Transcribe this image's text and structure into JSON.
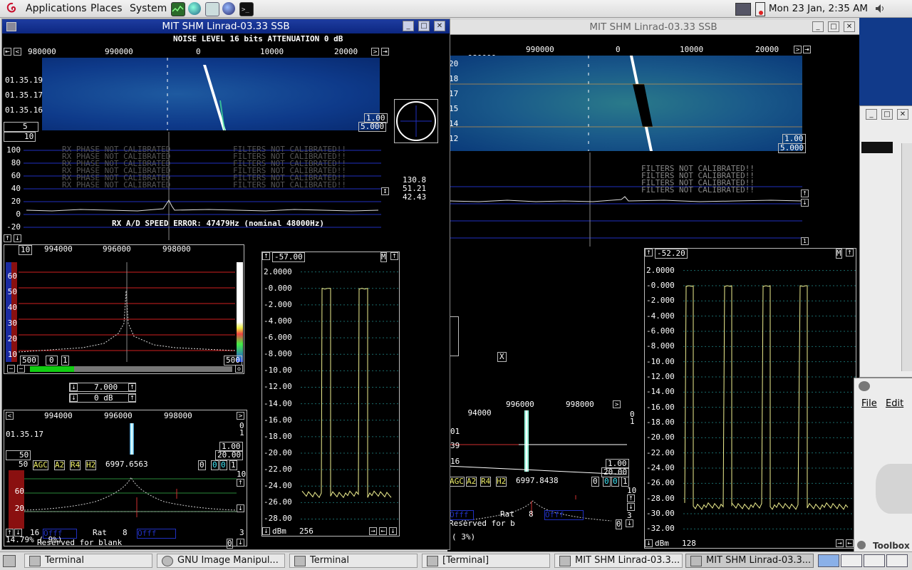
{
  "top_panel": {
    "menus": [
      "Applications",
      "Places",
      "System"
    ],
    "clock": "Mon 23 Jan,  2:35 AM"
  },
  "taskbar": {
    "items": [
      "Terminal",
      "GNU Image Manipul...",
      "Terminal",
      "[Terminal]",
      "MIT SHM Linrad-03.3...",
      "MIT SHM Linrad-03.3..."
    ]
  },
  "win1": {
    "title": "MIT SHM Linrad-03.33 SSB",
    "status": "NOISE LEVEL 16 bits ATTENUATION 0 dB",
    "scale_top": [
      "980000",
      "990000",
      "0",
      "10000",
      "20000"
    ],
    "timestamps": [
      "01.35.19",
      "01.35.17",
      "01.35.16"
    ],
    "wf_gain": "1.00",
    "wf_zero": "5.000",
    "wf_avg": "5",
    "spec_avg": "10",
    "spec_y": [
      "100",
      "80",
      "60",
      "40",
      "20",
      "0",
      "-20"
    ],
    "polar_vals": [
      "130.8",
      "51.21",
      "42.43"
    ],
    "filter_warning": "FILTERS NOT CALIBRATED!!",
    "phase_warning": "RX PHASE NOT CALIBRATED",
    "speed_error": "RX A/D SPEED ERROR: 47479Hz (nominal 48000Hz)",
    "bb_scale": [
      "994000",
      "996000",
      "998000"
    ],
    "bb_avg": "10",
    "bb_y": [
      "60",
      "50",
      "40",
      "30",
      "20",
      "10"
    ],
    "bb_bottom": [
      "500",
      "0",
      "1",
      "500"
    ],
    "freq": "7.000",
    "gain": "0 dB",
    "hires_scale": [
      "994000",
      "996000",
      "998000"
    ],
    "hires_time": "01.35.17",
    "hires_side": [
      "0",
      "1"
    ],
    "hires_gain": "1.00",
    "hires_zero": "20.00",
    "hires_avg": "50",
    "ctrl": {
      "left": "50",
      "agc": "AGC",
      "a2": "A2",
      "r4": "R4",
      "h2": "H2",
      "freq": "6997.6563",
      "v0": "0",
      "v1": "0",
      "v2": "0",
      "v3": "1"
    },
    "bfo_y": [
      "10",
      "60",
      "40",
      "20"
    ],
    "bfo_bottom": {
      "n": "16",
      "rat": "Rat",
      "rat_val": "8",
      "right": "3",
      "zero": "0"
    },
    "cpu": "14.79% ( 9%)",
    "reserved": "Reserved for blank"
  },
  "afc1": {
    "top": "-57.00",
    "m": "M",
    "y": [
      "2.0000",
      "-0.000",
      "-2.000",
      "-4.000",
      "-6.000",
      "-8.000",
      "-10.00",
      "-12.00",
      "-14.00",
      "-16.00",
      "-18.00",
      "-20.00",
      "-22.00",
      "-24.00",
      "-26.00",
      "-28.00"
    ],
    "unit": "dBm",
    "n": "256"
  },
  "win2": {
    "title": "MIT SHM Linrad-03.33 SSB",
    "scale_top": [
      "980000",
      "990000",
      "0",
      "10000",
      "20000"
    ],
    "timestamps": [
      "20",
      "18",
      "17",
      "15",
      "14",
      "12"
    ],
    "wf_gain": "1.00",
    "wf_zero": "5.000",
    "filter_warning": "FILTERS NOT CALIBRATED!!",
    "hires_scale": [
      "94000",
      "996000",
      "998000"
    ],
    "hires_side": [
      "0",
      "1"
    ],
    "hires_times": [
      "01",
      "39",
      "16"
    ],
    "hires_gain": "1.00",
    "hires_zero": "20.00",
    "ctrl": {
      "agc": "AGC",
      "a2": "A2",
      "r4": "R4",
      "h2": "H2",
      "freq": "6997.8438",
      "v0": "0",
      "v1": "0",
      "v2": "0",
      "v3": "1"
    },
    "bfo_y": [
      "10",
      "4",
      "0",
      "3"
    ],
    "bfo_bottom": {
      "rat": "Rat",
      "rat_val": "8"
    },
    "reserved": "Reserved for b",
    "cpu": "( 3%)",
    "close_x": "X"
  },
  "afc2": {
    "top": "-52.20",
    "m": "M",
    "y": [
      "2.0000",
      "-0.000",
      "-2.000",
      "-4.000",
      "-6.000",
      "-8.000",
      "-10.00",
      "-12.00",
      "-14.00",
      "-16.00",
      "-18.00",
      "-20.00",
      "-22.00",
      "-24.00",
      "-26.00",
      "-28.00",
      "-30.00",
      "-32.00"
    ],
    "unit": "dBm",
    "n": "128"
  },
  "gimp": {
    "menu_file": "File",
    "menu_edit": "Edit",
    "toolbox": "Toolbox"
  },
  "colors": {
    "trace": "#f0f090",
    "grid_red": "#d02020",
    "grid_blue": "#2030c0",
    "grid_green": "#20a040",
    "waterfall": "#0a3a8a"
  }
}
